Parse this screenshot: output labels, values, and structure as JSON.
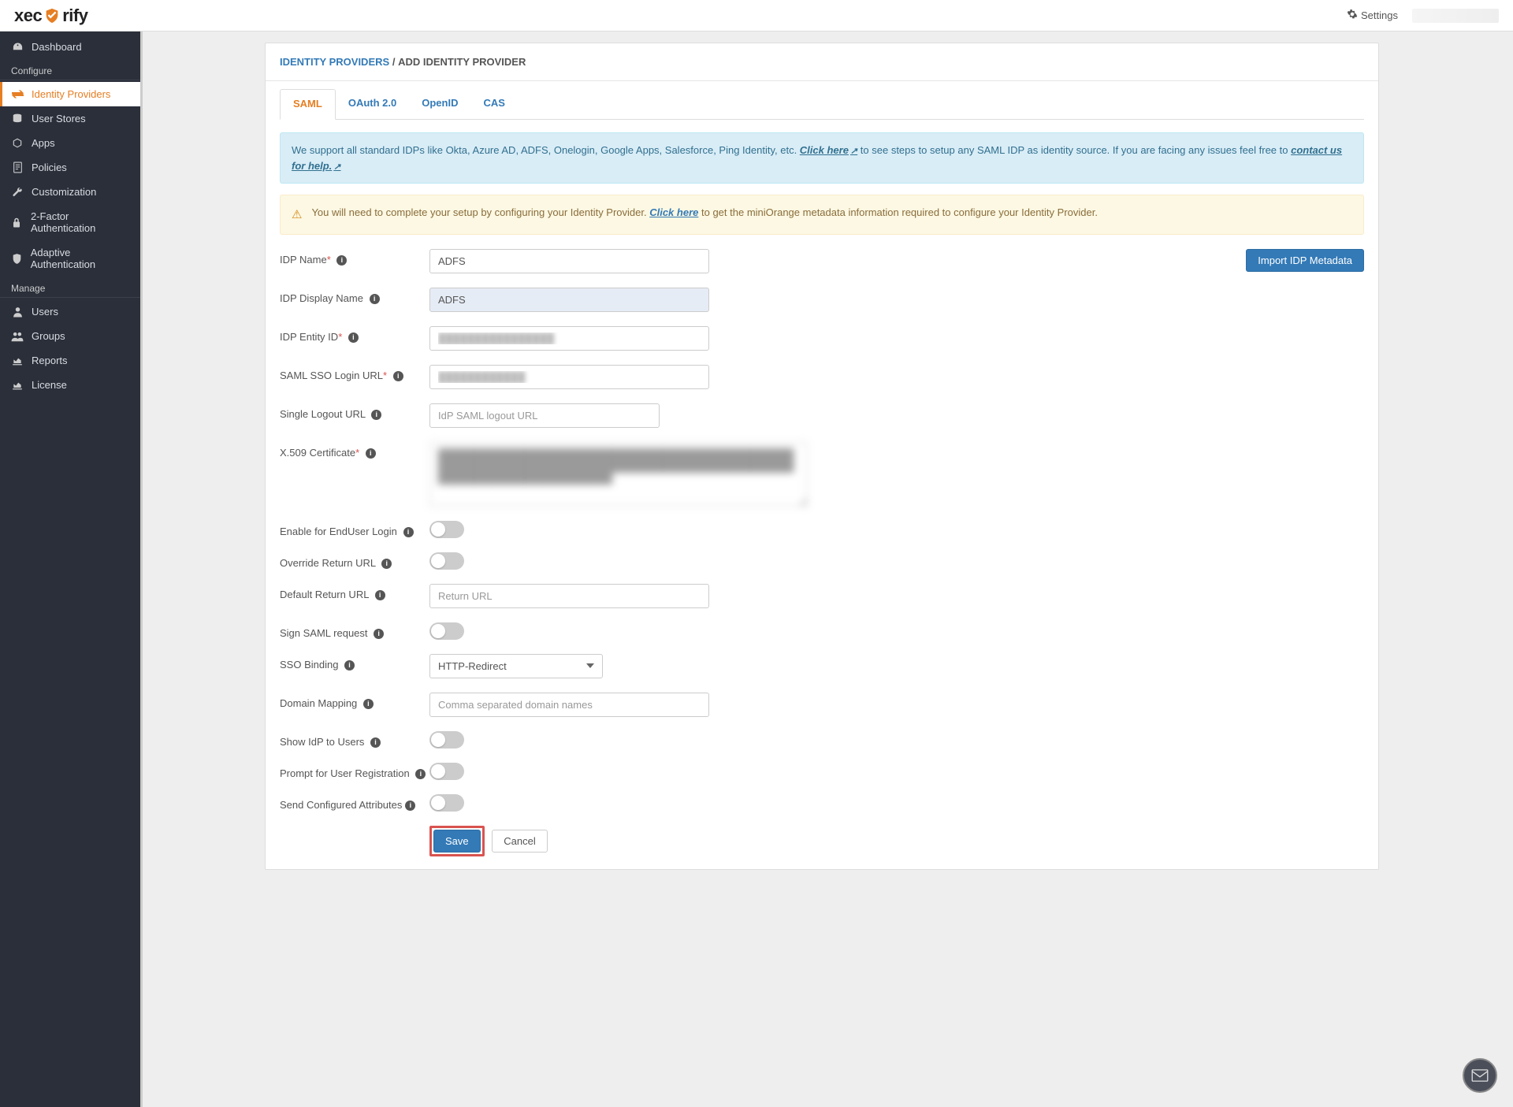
{
  "header": {
    "logo_left": "xec",
    "logo_right": "rify",
    "settings": "Settings"
  },
  "sidebar": {
    "items": [
      {
        "icon": "dashboard",
        "label": "Dashboard"
      }
    ],
    "section_configure": "Configure",
    "configure_items": [
      {
        "icon": "exchange",
        "label": "Identity Providers",
        "active": true
      },
      {
        "icon": "database",
        "label": "User Stores"
      },
      {
        "icon": "cube",
        "label": "Apps"
      },
      {
        "icon": "file",
        "label": "Policies"
      },
      {
        "icon": "wrench",
        "label": "Customization"
      },
      {
        "icon": "lock",
        "label": "2-Factor Authentication"
      },
      {
        "icon": "shield",
        "label": "Adaptive Authentication"
      }
    ],
    "section_manage": "Manage",
    "manage_items": [
      {
        "icon": "user",
        "label": "Users"
      },
      {
        "icon": "users",
        "label": "Groups"
      },
      {
        "icon": "chart",
        "label": "Reports"
      },
      {
        "icon": "chart",
        "label": "License"
      }
    ]
  },
  "breadcrumb": {
    "link": "IDENTITY PROVIDERS",
    "sep": "/",
    "current": "ADD IDENTITY PROVIDER"
  },
  "tabs": [
    {
      "label": "SAML",
      "active": true
    },
    {
      "label": "OAuth 2.0"
    },
    {
      "label": "OpenID"
    },
    {
      "label": "CAS"
    }
  ],
  "info_alert": {
    "text1": "We support all standard IDPs like Okta, Azure AD, ADFS, Onelogin, Google Apps, Salesforce, Ping Identity, etc. ",
    "link1": "Click here",
    "text2": " to see steps to setup any SAML IDP as identity source. If you are facing any issues feel free to ",
    "link2": "contact us for help."
  },
  "warn_alert": {
    "text1": "You will need to complete your setup by configuring your Identity Provider. ",
    "link": "Click here",
    "text2": " to get the miniOrange metadata information required to configure your Identity Provider."
  },
  "buttons": {
    "import": "Import IDP Metadata",
    "save": "Save",
    "cancel": "Cancel"
  },
  "form": {
    "idp_name_label": "IDP Name",
    "idp_name_value": "ADFS",
    "idp_display_label": "IDP Display Name",
    "idp_display_value": "ADFS",
    "idp_entity_label": "IDP Entity ID",
    "idp_entity_value": "████████████████",
    "sso_url_label": "SAML SSO Login URL",
    "sso_url_value": "████████████",
    "slo_url_label": "Single Logout URL",
    "slo_url_placeholder": "IdP SAML logout URL",
    "cert_label": "X.509 Certificate",
    "cert_value": "██████████████████████████████████████████████████████████████████████████████████████████████████████████████████████████",
    "enable_enduser_label": "Enable for EndUser Login",
    "override_return_label": "Override Return URL",
    "default_return_label": "Default Return URL",
    "default_return_placeholder": "Return URL",
    "sign_saml_label": "Sign SAML request",
    "sso_binding_label": "SSO Binding",
    "sso_binding_value": "HTTP-Redirect",
    "domain_mapping_label": "Domain Mapping",
    "domain_mapping_placeholder": "Comma separated domain names",
    "show_idp_label": "Show IdP to Users",
    "prompt_reg_label": "Prompt for User Registration",
    "send_attrs_label": "Send Configured Attributes"
  }
}
